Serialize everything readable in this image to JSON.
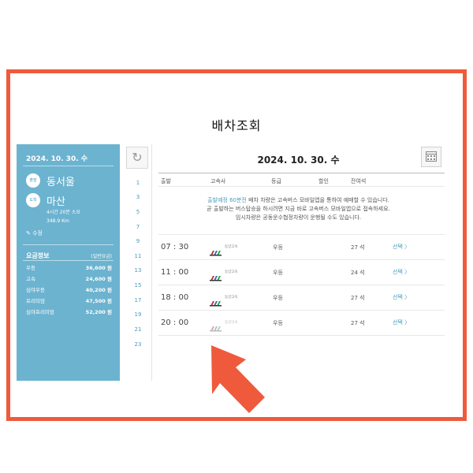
{
  "page_title": "배차조회",
  "sidebar": {
    "date": "2024. 10. 30. 수",
    "departure": {
      "badge": "출발",
      "city": "동서울"
    },
    "arrival": {
      "badge": "도착",
      "city": "마산"
    },
    "duration": "4시간 20분 소요",
    "distance": "348.9 Km",
    "edit_label": "수정",
    "fare": {
      "title": "요금정보",
      "note": "(일반요금)",
      "rows": [
        {
          "grade": "우등",
          "price": "36,600 원"
        },
        {
          "grade": "고속",
          "price": "24,600 원"
        },
        {
          "grade": "심야우등",
          "price": "40,200 원"
        },
        {
          "grade": "프리미엄",
          "price": "47,500 원"
        },
        {
          "grade": "심야프리미엄",
          "price": "52,200 원"
        }
      ]
    }
  },
  "hour_rail": [
    "1",
    "3",
    "5",
    "7",
    "9",
    "11",
    "13",
    "15",
    "17",
    "19",
    "21",
    "23"
  ],
  "main": {
    "date": "2024. 10. 30. 수",
    "headers": [
      "출발",
      "고속사",
      "등급",
      "할인",
      "잔여석"
    ],
    "notice": {
      "highlight": "출발예정 60분전",
      "line1_rest": " 배차 차량은 고속버스 모바일앱을 통하여 예매할 수 있습니다.",
      "line2": "곧 출발하는 버스탑승을 하시려면 지금 바로 고속버스 모바일앱으로 접속하세요.",
      "line3": "임시차량은 공동운수협정차량이 운행될 수도 있습니다."
    },
    "schedules": [
      {
        "time": "07 : 30",
        "company": "동양고속",
        "grade": "우등",
        "seats": "27 석",
        "action": "선택 〉"
      },
      {
        "time": "11 : 00",
        "company": "동양고속",
        "grade": "우등",
        "seats": "24 석",
        "action": "선택 〉"
      },
      {
        "time": "18 : 00",
        "company": "동양고속",
        "grade": "우등",
        "seats": "27 석",
        "action": "선택 〉"
      },
      {
        "time": "20 : 00",
        "company": "동양고속",
        "grade": "우등",
        "seats": "27 석",
        "action": "선택 〉"
      }
    ]
  },
  "colors": {
    "frame": "#ef5a3c",
    "sidebar": "#6cb3d0",
    "accent": "#4a9bbf",
    "arrow": "#ef5a3c"
  },
  "icons": {
    "refresh": "refresh-icon",
    "calendar": "calendar-icon",
    "edit": "pencil-icon",
    "pointer": "up-arrow-icon"
  }
}
